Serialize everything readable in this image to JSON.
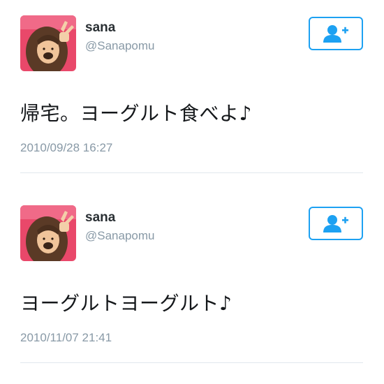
{
  "colors": {
    "accent": "#1da1f2",
    "secondary_text": "#8899a6",
    "primary_text": "#14171a",
    "divider": "#e1e8ed"
  },
  "tweets": [
    {
      "user": {
        "name": "sana",
        "handle": "@Sanapomu",
        "avatar_icon": "user-photo-avatar"
      },
      "follow_icon": "follow-user-plus-icon",
      "text": "帰宅。ヨーグルト食べよ♪",
      "timestamp": "2010/09/28 16:27"
    },
    {
      "user": {
        "name": "sana",
        "handle": "@Sanapomu",
        "avatar_icon": "user-photo-avatar"
      },
      "follow_icon": "follow-user-plus-icon",
      "text": "ヨーグルトヨーグルト♪",
      "timestamp": "2010/11/07 21:41"
    }
  ]
}
